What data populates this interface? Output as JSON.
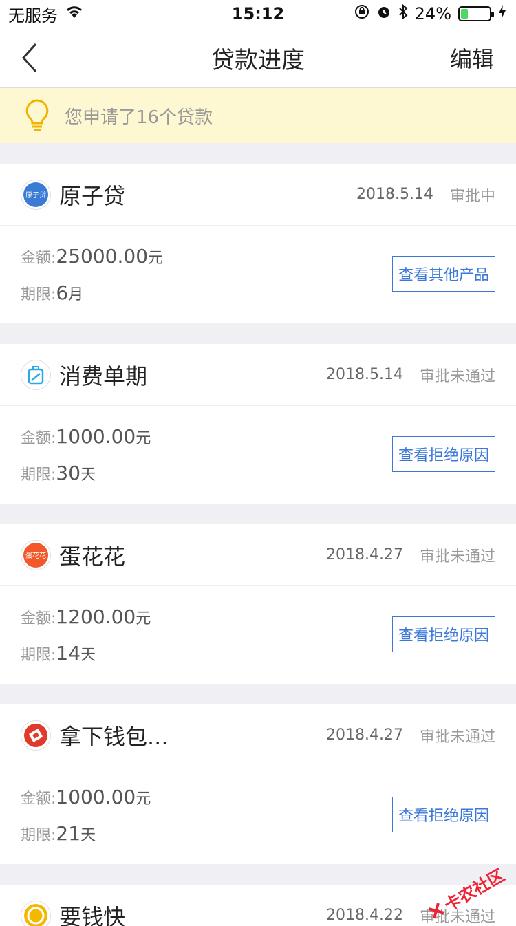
{
  "status_bar": {
    "carrier": "无服务",
    "time": "15:12",
    "battery_percent": "24%",
    "battery_level": 0.24
  },
  "nav": {
    "title": "贷款进度",
    "edit_label": "编辑"
  },
  "notice": {
    "text": "您申请了16个贷款"
  },
  "labels": {
    "amount": "金额:",
    "term": "期限:"
  },
  "loans": [
    {
      "name": "原子贷",
      "date": "2018.5.14",
      "status": "审批中",
      "amount": "25000.00",
      "amount_unit": "元",
      "term_value": "6",
      "term_unit": "月",
      "action": "查看其他产品",
      "logo_text": "原子贷",
      "logo_color": "#3a7bd5"
    },
    {
      "name": "消费单期",
      "date": "2018.5.14",
      "status": "审批未通过",
      "amount": "1000.00",
      "amount_unit": "元",
      "term_value": "30",
      "term_unit": "天",
      "action": "查看拒绝原因",
      "logo_text": "",
      "logo_color": "#2aa8e8"
    },
    {
      "name": "蛋花花",
      "date": "2018.4.27",
      "status": "审批未通过",
      "amount": "1200.00",
      "amount_unit": "元",
      "term_value": "14",
      "term_unit": "天",
      "action": "查看拒绝原因",
      "logo_text": "蛋花花",
      "logo_color": "#f2582a"
    },
    {
      "name": "拿下钱包...",
      "date": "2018.4.27",
      "status": "审批未通过",
      "amount": "1000.00",
      "amount_unit": "元",
      "term_value": "21",
      "term_unit": "天",
      "action": "查看拒绝原因",
      "logo_text": "",
      "logo_color": "#e23a2a"
    },
    {
      "name": "要钱快",
      "date": "2018.4.22",
      "status": "审批未通过",
      "logo_color": "#f5b800"
    }
  ],
  "watermark": "卡农社区"
}
